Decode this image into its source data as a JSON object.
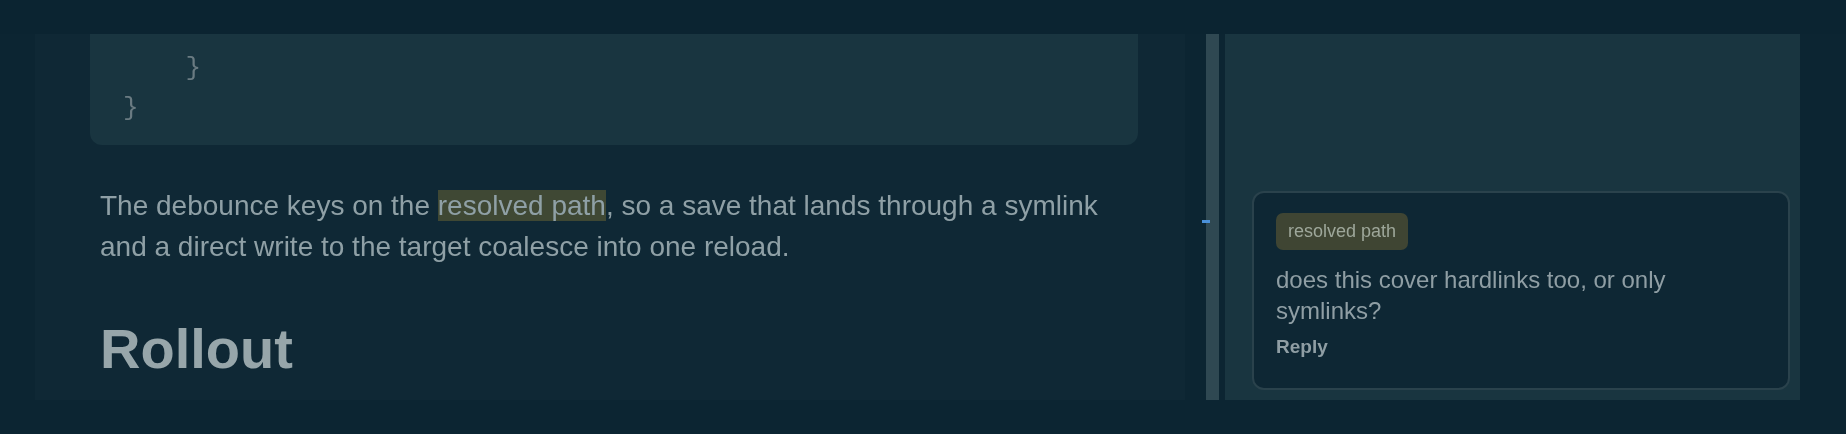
{
  "code_block": {
    "lines": [
      "    }",
      "}"
    ]
  },
  "paragraph": {
    "parts": [
      {
        "text": "The debounce keys on the ",
        "highlighted": false
      },
      {
        "text": "resolved path",
        "highlighted": true
      },
      {
        "text": ", so a save that lands through a symlink and a direct write to the target coalesce into one reload.",
        "highlighted": false
      }
    ]
  },
  "heading": "Rollout",
  "comment": {
    "tag": "resolved path",
    "text": "does this cover hardlinks too, or only symlinks?",
    "action": "Reply"
  }
}
